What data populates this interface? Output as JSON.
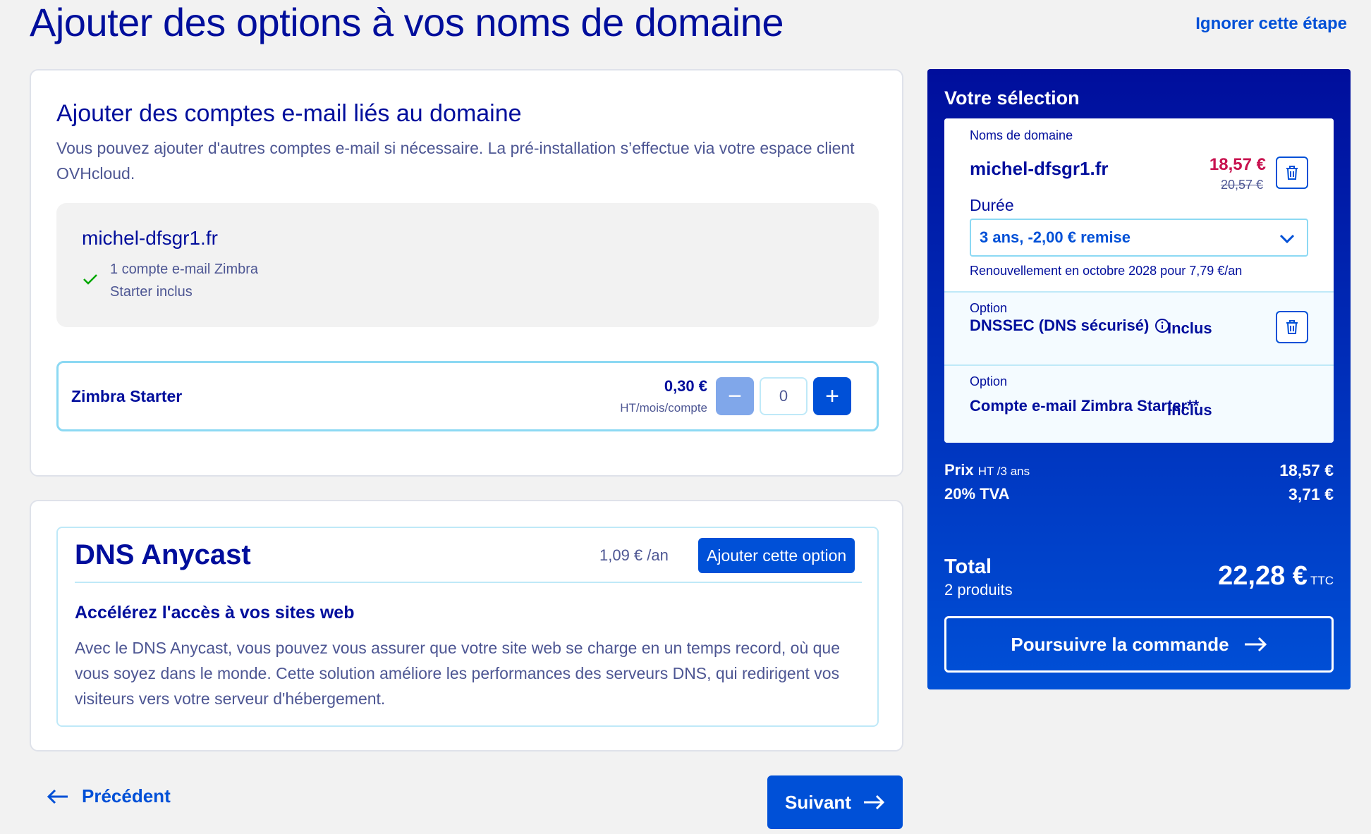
{
  "header": {
    "title": "Ajouter des options à vos noms de domaine",
    "skip_label": "Ignorer cette étape"
  },
  "email_section": {
    "title": "Ajouter des comptes e-mail liés au domaine",
    "description": "Vous pouvez ajouter d'autres comptes e-mail si nécessaire. La pré-installation s’effectue via votre espace client OVHcloud.",
    "domain": "michel-dfsgr1.fr",
    "included_line1": "1 compte e-mail Zimbra",
    "included_line2": "Starter inclus",
    "product": {
      "name": "Zimbra Starter",
      "price": "0,30 €",
      "price_unit": "HT/mois/compte",
      "quantity": "0",
      "minus": "−",
      "plus": "+"
    }
  },
  "dns_section": {
    "title": "DNS Anycast",
    "price": "1,09 €  /an",
    "add_label": "Ajouter cette option",
    "subtitle": "Accélérez l'accès à vos sites web",
    "description": "Avec le DNS Anycast, vous pouvez vous assurer que votre site web se charge en un temps record, où que vous soyez dans le monde. Cette solution améliore les performances des serveurs DNS, qui redirigent vos visiteurs vers votre serveur d'hébergement."
  },
  "navigation": {
    "previous_label": "Précédent",
    "next_label": "Suivant"
  },
  "summary": {
    "title": "Votre sélection",
    "domain_section_label": "Noms de domaine",
    "domain": "michel-dfsgr1.fr",
    "price_new": "18,57 €",
    "price_old": "20,57 €",
    "duration_label": "Durée",
    "duration_value": "3 ans, -2,00 € remise",
    "renewal": "Renouvellement en octobre 2028 pour 7,79 €/an",
    "options": [
      {
        "label": "Option",
        "name": "DNSSEC (DNS sécurisé)",
        "status": "Inclus"
      },
      {
        "label": "Option",
        "name": "Compte e-mail Zimbra Starter**",
        "status": "Inclus"
      }
    ],
    "price_label": "Prix",
    "price_qualifier": "HT /3 ans",
    "price_value": "18,57 €",
    "vat_label": "20% TVA",
    "vat_value": "3,71 €",
    "total_label": "Total",
    "total_products": "2 produits",
    "total_value": "22,28 €",
    "total_suffix": "TTC",
    "checkout_label": "Poursuivre la commande"
  },
  "colors": {
    "primary": "#0050d7",
    "dark_blue": "#000e9c",
    "promo_price": "#c8124f",
    "check_green": "#00a800"
  },
  "icons": [
    "check-icon",
    "minus-icon",
    "plus-icon",
    "trash-icon",
    "chevron-down-icon",
    "info-icon",
    "arrow-left-icon",
    "arrow-right-icon"
  ]
}
